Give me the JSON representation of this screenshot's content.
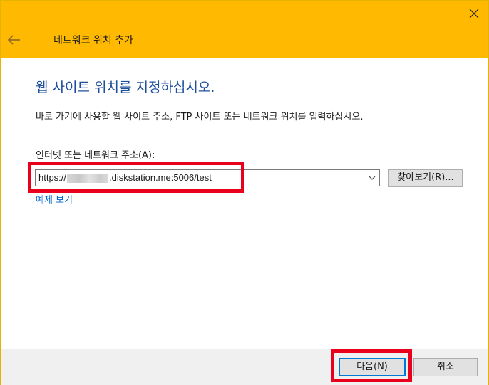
{
  "window": {
    "title": "네트워크 위치 추가",
    "accent_color": "#ffb900",
    "back_icon": "arrow-left-icon",
    "close_icon": "close-icon"
  },
  "main": {
    "heading": "웹 사이트 위치를 지정하십시오.",
    "heading_color": "#1e4e9c",
    "instruction": "바로 가기에 사용할 웹 사이트 주소, FTP 사이트 또는 네트워크 위치를 입력하십시오.",
    "address_label": "인터넷 또는 네트워크 주소(A):",
    "address_prefix": "https://",
    "address_suffix": ".diskstation.me:5006/test",
    "browse_label": "찾아보기(R)...",
    "example_link": "예제 보기"
  },
  "footer": {
    "next_label": "다음(N)",
    "cancel_label": "취소"
  },
  "annotations": {
    "highlight_color": "#e8001c"
  }
}
